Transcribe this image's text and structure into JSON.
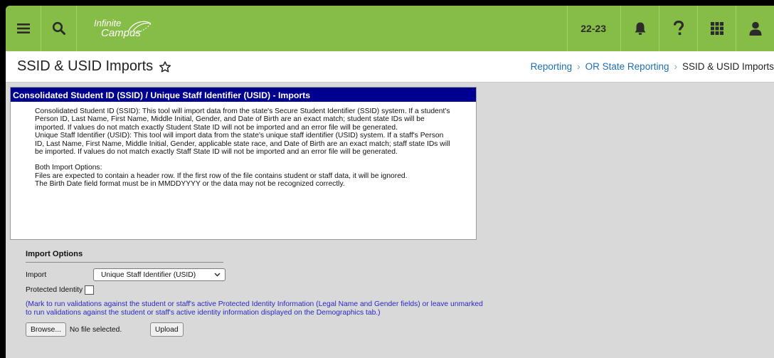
{
  "topbar": {
    "logo_line1": "Infinite",
    "logo_line2": "Campus",
    "year": "22-23",
    "colors": {
      "bar": "#86bd47",
      "icon": "#2b2b2b"
    },
    "icons": [
      "menu-icon",
      "search-icon",
      "bell-icon",
      "help-icon",
      "apps-grid-icon",
      "user-icon"
    ]
  },
  "header": {
    "title": "SSID & USID Imports",
    "breadcrumb": [
      "Reporting",
      "OR State Reporting",
      "SSID & USID Imports"
    ]
  },
  "panel": {
    "heading": "Consolidated Student ID (SSID) / Unique Staff Identifier (USID) - Imports",
    "para_ssid": "Consolidated Student ID (SSID): This tool will import data from the state's Secure Student Identifier (SSID) system. If a student's Person ID, Last Name, First Name, Middle Initial, Gender, and Date of Birth are an exact match; student state IDs will be imported. If values do not match exactly Student State ID will not be imported and an error file will be generated.",
    "para_usid": "Unique Staff Identifier (USID): This tool will import data from the state's unique staff identifier (USID) system. If a staff's Person ID, Last Name, First Name, Middle Initial, Gender, applicable state race, and Date of Birth are an exact match; staff state IDs will be imported. If values do not match exactly Staff State ID will not be imported and an error file will be generated.",
    "both_title": "Both Import Options:",
    "both_line1": "Files are expected to contain a header row. If the first row of the file contains student or staff data, it will be ignored.",
    "both_line2": "The Birth Date field format must be in MMDDYYYY or the data may not be recognized correctly.",
    "colors": {
      "heading_bg": "#000090"
    }
  },
  "options": {
    "title": "Import Options",
    "import_label": "Import",
    "import_value": "Unique Staff Identifier (USID)",
    "protected_label": "Protected Identity",
    "protected_checked": false,
    "note": "(Mark to run validations against the student or staff's active Protected Identity Information (Legal Name and Gender fields) or leave unmarked to run validations against the student or staff's active identity information displayed on the Demographics tab.)",
    "browse_label": "Browse...",
    "file_status": "No file selected.",
    "upload_label": "Upload"
  }
}
